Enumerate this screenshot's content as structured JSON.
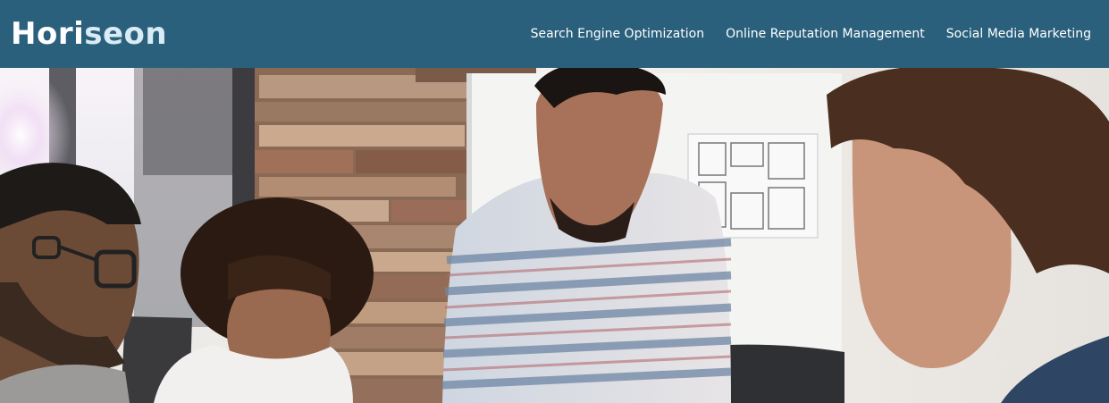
{
  "header": {
    "logo_prefix": "Hori",
    "logo_accent": "seon",
    "nav": [
      {
        "label": "Search Engine Optimization"
      },
      {
        "label": "Online Reputation Management"
      },
      {
        "label": "Social Media Marketing"
      }
    ]
  },
  "colors": {
    "header_bg": "#2a607c",
    "logo_accent": "#d9ebf4",
    "nav_text": "#ffffff"
  },
  "hero": {
    "image_subject": "team-meeting-photo"
  }
}
